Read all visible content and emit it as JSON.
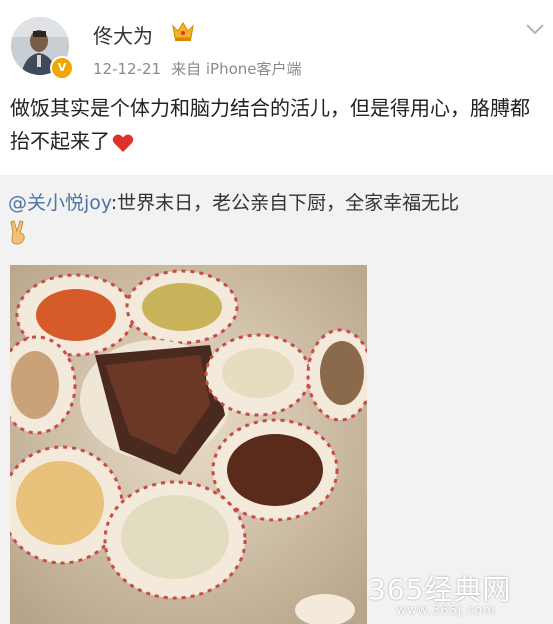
{
  "post": {
    "author": "佟大为",
    "time": "12-12-21",
    "source": "来自 iPhone客户端",
    "text": "做饭其实是个体力和脑力结合的活儿，但是得用心，胳膊都抬不起来了"
  },
  "repost": {
    "mention": "@关小悦joy",
    "text": ":世界末日，老公亲自下厨，全家幸福无比"
  },
  "watermark": {
    "brand": "365经典网",
    "url": "www.365j.com"
  },
  "icons": [
    "avatar",
    "verified-badge",
    "crown-icon",
    "chevron-down-icon",
    "heart-icon",
    "victory-hand-icon"
  ],
  "colors": {
    "link": "#4e74a4",
    "meta": "#8a8a8a",
    "repost_bg": "#f2f2f2",
    "heart": "#e0302a"
  }
}
